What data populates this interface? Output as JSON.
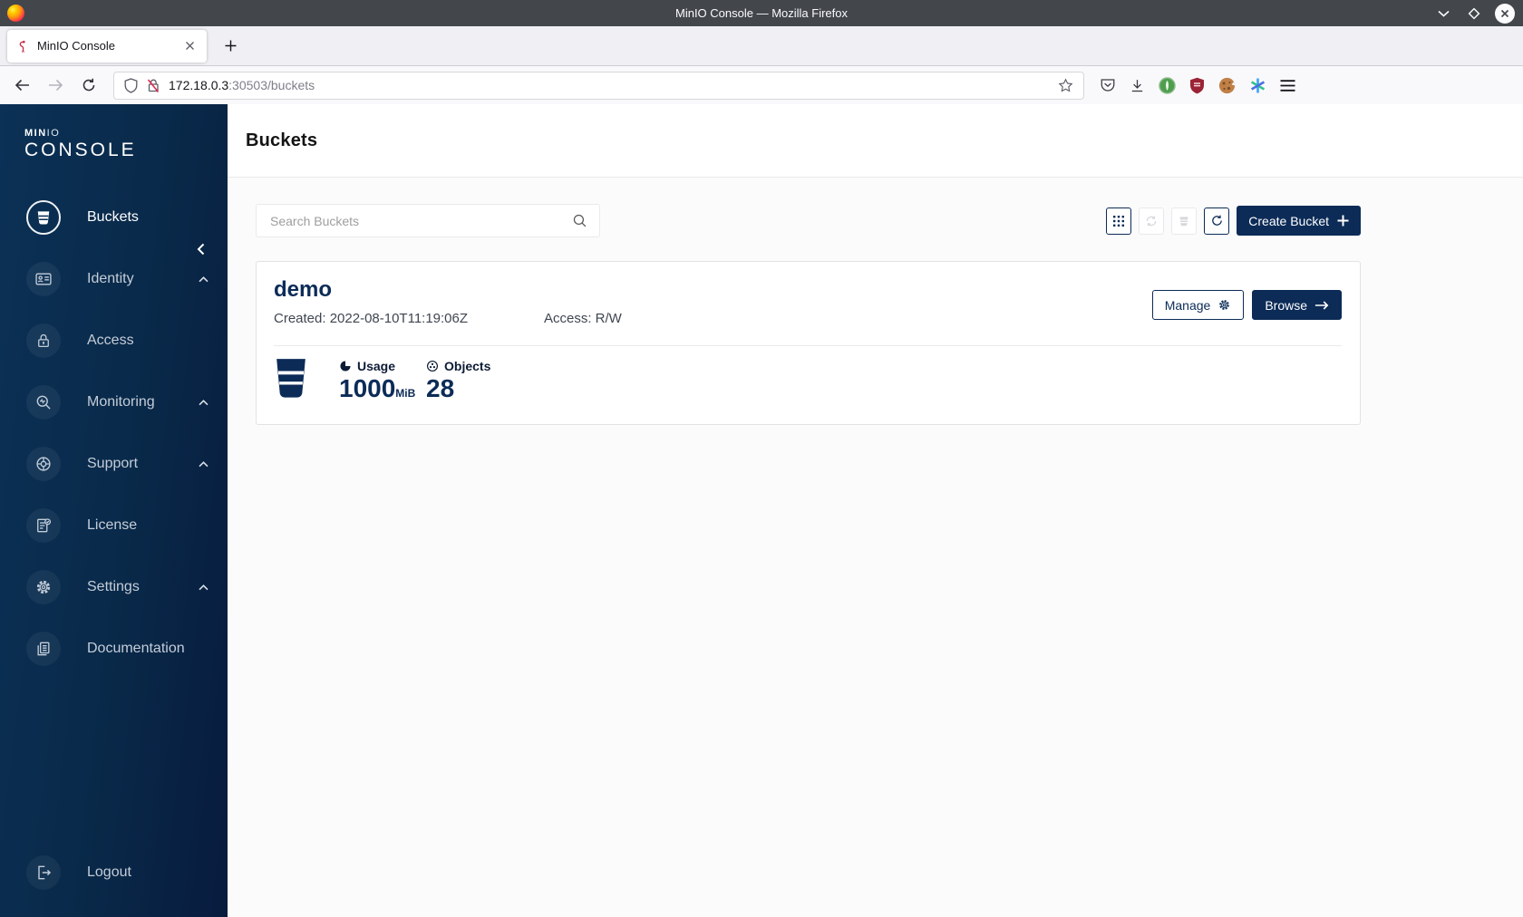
{
  "window": {
    "title": "MinIO Console — Mozilla Firefox"
  },
  "browser": {
    "tab": {
      "title": "MinIO Console"
    },
    "url": {
      "host": "172.18.0.3",
      "path": ":30503/buckets"
    }
  },
  "sidebar": {
    "logo_bold": "MIN",
    "logo_light": "IO",
    "logo_sub": "CONSOLE",
    "items": [
      {
        "label": "Buckets",
        "icon": "bucket-icon",
        "active": true,
        "expandable": false
      },
      {
        "label": "Identity",
        "icon": "identity-card-icon",
        "active": false,
        "expandable": true
      },
      {
        "label": "Access",
        "icon": "lock-icon",
        "active": false,
        "expandable": false
      },
      {
        "label": "Monitoring",
        "icon": "monitoring-icon",
        "active": false,
        "expandable": true
      },
      {
        "label": "Support",
        "icon": "lifebuoy-icon",
        "active": false,
        "expandable": true
      },
      {
        "label": "License",
        "icon": "license-icon",
        "active": false,
        "expandable": false
      },
      {
        "label": "Settings",
        "icon": "gear-icon",
        "active": false,
        "expandable": true
      },
      {
        "label": "Documentation",
        "icon": "documentation-icon",
        "active": false,
        "expandable": false
      }
    ],
    "logout_label": "Logout"
  },
  "page": {
    "title": "Buckets",
    "search_placeholder": "Search Buckets",
    "create_button": "Create Bucket",
    "toolbar_icons": [
      "grid-view-icon",
      "replication-icon-disabled",
      "multi-bucket-icon-disabled",
      "refresh-icon"
    ],
    "bucket": {
      "name": "demo",
      "created_label": "Created: 2022-08-10T11:19:06Z",
      "access_label": "Access: R/W",
      "usage_label": "Usage",
      "usage_value": "1000",
      "usage_unit": "MiB",
      "objects_label": "Objects",
      "objects_value": "28",
      "manage_button": "Manage",
      "browse_button": "Browse"
    }
  },
  "colors": {
    "brand_navy": "#0c2b57",
    "sidebar_gradient_start": "#0b3156",
    "sidebar_gradient_end": "#081b3e",
    "minio_flamingo_red": "#c72c48",
    "titlebar_gray": "#43474b",
    "content_background": "#fbfbfb"
  }
}
